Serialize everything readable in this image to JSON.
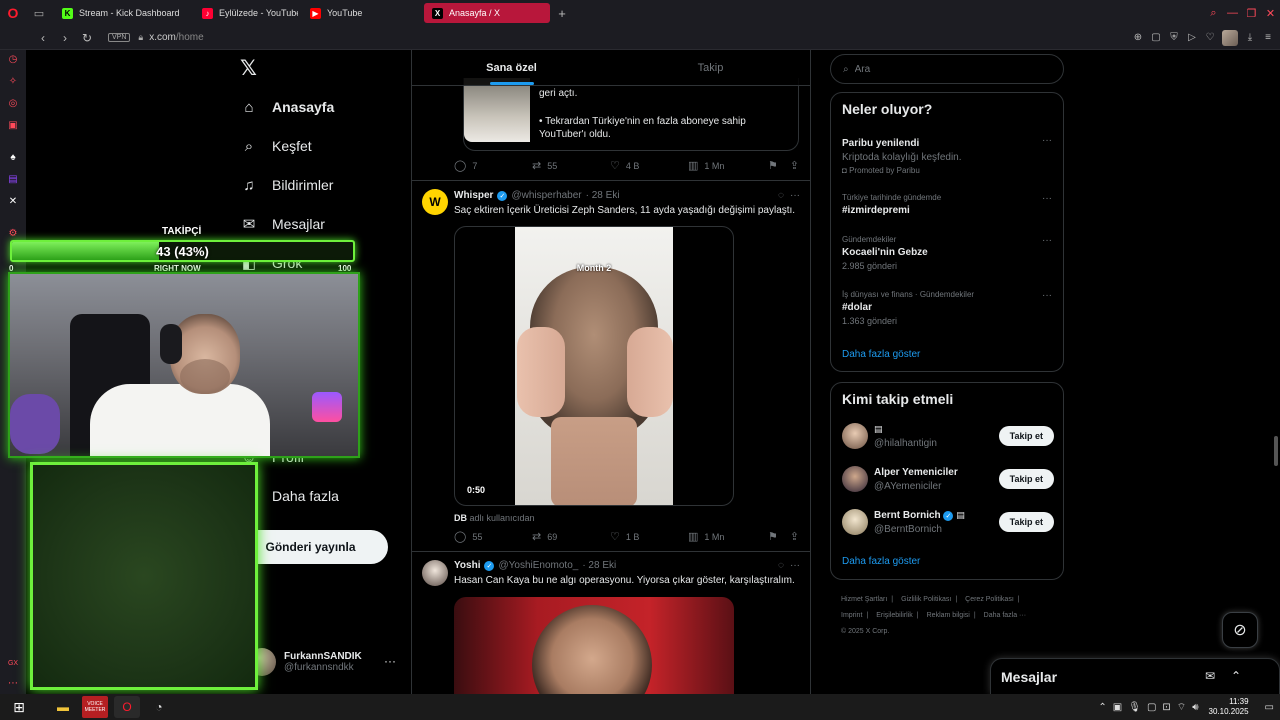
{
  "browser": {
    "tabs": [
      {
        "label": "Stream - Kick Dashboard",
        "fav": "K",
        "color": "#53fc18",
        "active": false
      },
      {
        "label": "Eylülzede - YouTube Music",
        "fav": "♪",
        "color": "#ff0033",
        "active": false
      },
      {
        "label": "YouTube",
        "fav": "▶",
        "color": "#ff0000",
        "active": false
      },
      {
        "label": "Anasayfa / X",
        "fav": "X",
        "color": "#000000",
        "active": true
      }
    ],
    "vpn": "VPN",
    "url_host": "x.com",
    "url_path": "/home"
  },
  "nav": {
    "items": [
      {
        "label": "Anasayfa",
        "icon": "home-icon",
        "glyph": "⌂",
        "bold": true
      },
      {
        "label": "Keşfet",
        "icon": "search-icon",
        "glyph": "⌕",
        "bold": false
      },
      {
        "label": "Bildirimler",
        "icon": "bell-icon",
        "glyph": "♫",
        "bold": false
      },
      {
        "label": "Mesajlar",
        "icon": "mail-icon",
        "glyph": "✉",
        "bold": false
      },
      {
        "label": "Grok",
        "icon": "grok-icon",
        "glyph": "◧",
        "bold": false
      },
      {
        "label": "Profil",
        "icon": "profile-icon",
        "glyph": "☺",
        "bold": false
      },
      {
        "label": "Daha fazla",
        "icon": "more-icon",
        "glyph": "⋯",
        "bold": false
      }
    ],
    "post_button": "Gönderi yayınla",
    "account": {
      "name": "FurkannSANDIK",
      "handle": "@furkannsndkk"
    }
  },
  "timeline": {
    "tabs": [
      "Sana özel",
      "Takip"
    ],
    "prev_post": {
      "text1": "geri açtı.",
      "text2": "• Tekrardan Türkiye'nin en fazla aboneye sahip YouTuber'ı oldu.",
      "replies": "7",
      "reposts": "55",
      "likes": "4 B",
      "views": "1 Mn"
    },
    "post1": {
      "name": "Whisper",
      "handle": "@whisperhaber",
      "date": "· 28 Eki",
      "text": "Saç ektiren İçerik Üreticisi Zeph Sanders, 11 ayda yaşadığı değişimi paylaştı.",
      "video_caption": "Month 2",
      "duration": "0:50",
      "attribution_user": "DB",
      "attribution_text": "adlı kullanıcıdan",
      "replies": "55",
      "reposts": "69",
      "likes": "1 B",
      "views": "1 Mn"
    },
    "post2": {
      "name": "Yoshi",
      "handle": "@YoshiEnomoto_",
      "date": "· 28 Eki",
      "text": "Hasan Can Kaya bu ne algı operasyonu. Yiyorsa çıkar göster, karşılaştıralım."
    }
  },
  "right": {
    "search_placeholder": "Ara",
    "trends_title": "Neler oluyor?",
    "trends": [
      {
        "context": "",
        "title": "Paribu yenilendi",
        "sub": "Kriptoda kolaylığı keşfedin.",
        "promo": "Promoted by Paribu"
      },
      {
        "context": "Türkiye tarihinde gündemde",
        "title": "#izmirdepremi",
        "sub": "",
        "promo": ""
      },
      {
        "context": "Gündemdekiler",
        "title": "Kocaeli'nin Gebze",
        "sub": "2.985 gönderi",
        "promo": ""
      },
      {
        "context": "İş dünyası ve finans · Gündemdekiler",
        "title": "#dolar",
        "sub": "1.363 gönderi",
        "promo": ""
      }
    ],
    "show_more": "Daha fazla göster",
    "wtf_title": "Kimi takip etmeli",
    "wtf": [
      {
        "name": "",
        "handle": "@hilalhantigin",
        "button": "Takip et",
        "verified": false
      },
      {
        "name": "Alper Yemeniciler",
        "handle": "@AYemeniciler",
        "button": "Takip et",
        "verified": false
      },
      {
        "name": "Bernt Bornich",
        "handle": "@BerntBornich",
        "button": "Takip et",
        "verified": true
      }
    ],
    "footer": [
      "Hizmet Şartları",
      "Gizlilik Politikası",
      "Çerez Politikası",
      "Imprint",
      "Erişilebilirlik",
      "Reklam bilgisi",
      "Daha fazla ···",
      "© 2025 X Corp."
    ]
  },
  "dm_drawer": {
    "title": "Mesajlar"
  },
  "overlay": {
    "follow_label": "TAKİPÇİ",
    "follow_text": "43 (43%)",
    "follow_progress": 0.43,
    "right_now": "RIGHT NOW",
    "min": "0",
    "max": "100"
  },
  "taskbar": {
    "time": "11:39",
    "date": "30.10.2025",
    "app_label": "VOICE MEETER"
  }
}
